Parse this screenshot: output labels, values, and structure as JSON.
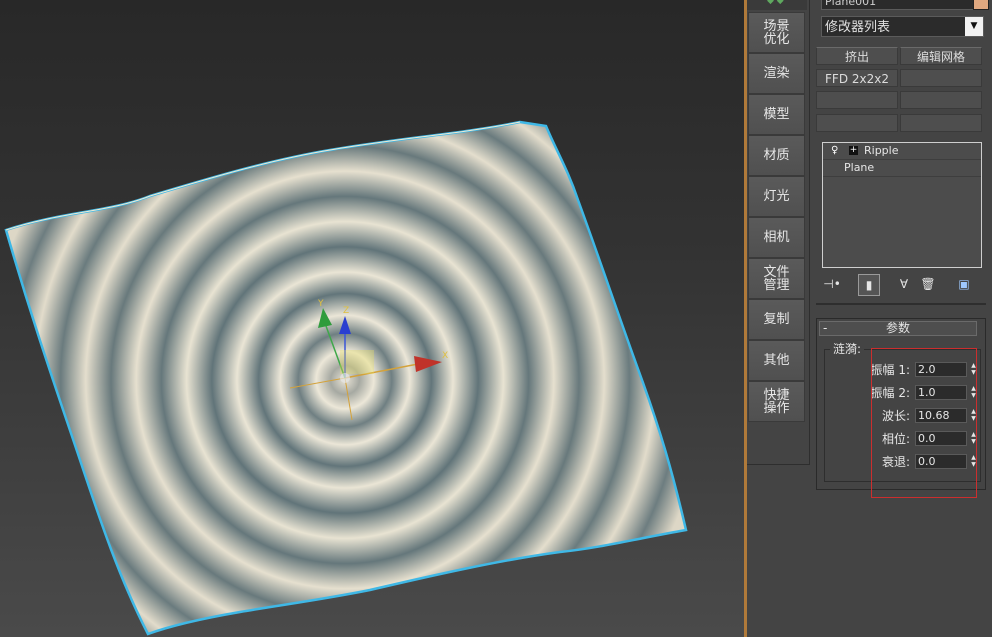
{
  "object": {
    "name": "Plane001",
    "color": "#e0a880"
  },
  "modifier_list": {
    "label": "修改器列表"
  },
  "modifier_buttons": [
    {
      "label": "挤出"
    },
    {
      "label": "编辑网格"
    },
    {
      "label": "FFD 2x2x2"
    },
    {
      "label": ""
    },
    {
      "label": ""
    },
    {
      "label": ""
    },
    {
      "label": ""
    },
    {
      "label": ""
    }
  ],
  "stack": {
    "items": [
      {
        "label": "Ripple"
      },
      {
        "label": "Plane"
      }
    ]
  },
  "side_menu": {
    "items": [
      {
        "label": "场景\n优化"
      },
      {
        "label": "渲染"
      },
      {
        "label": "模型"
      },
      {
        "label": "材质"
      },
      {
        "label": "灯光"
      },
      {
        "label": "相机"
      },
      {
        "label": "文件\n管理"
      },
      {
        "label": "复制"
      },
      {
        "label": "其他"
      },
      {
        "label": "快捷\n操作"
      }
    ]
  },
  "parameters": {
    "title": "参数",
    "collapse": "-",
    "group_label": "涟漪:",
    "fields": [
      {
        "label": "振幅 1:",
        "value": "2.0"
      },
      {
        "label": "振幅 2:",
        "value": "1.0"
      },
      {
        "label": "波长:",
        "value": "10.68"
      },
      {
        "label": "相位:",
        "value": "0.0"
      },
      {
        "label": "衰退:",
        "value": "0.0"
      }
    ]
  },
  "gizmo": {
    "x_label": "X",
    "y_label": "Y",
    "z_label": "Z"
  },
  "colors": {
    "selection": "#3fb8e6",
    "highlight_box": "#cc2e2e"
  }
}
